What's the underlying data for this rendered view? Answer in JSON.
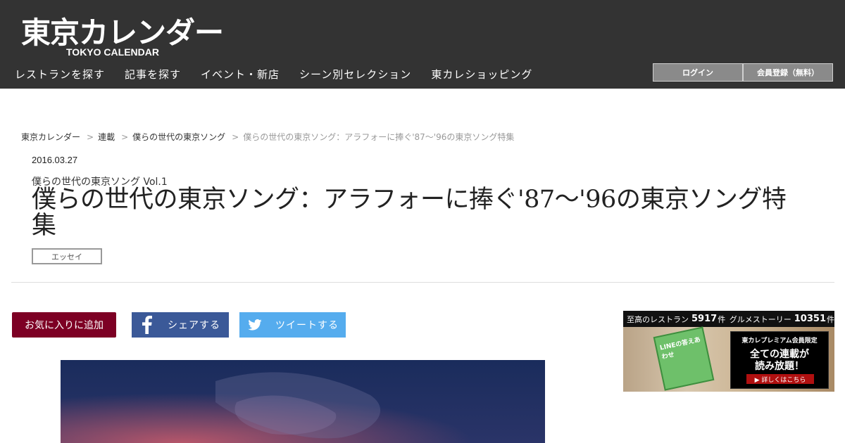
{
  "header": {
    "logo_jp": "東京カレンダー",
    "logo_en": "TOKYO CALENDAR",
    "nav": [
      {
        "label": "レストランを探す"
      },
      {
        "label": "記事を探す"
      },
      {
        "label": "イベント・新店"
      },
      {
        "label": "シーン別セレクション"
      },
      {
        "label": "東カレショッピング"
      }
    ],
    "login_label": "ログイン",
    "register_label": "会員登録（無料）"
  },
  "breadcrumb": {
    "items": [
      "東京カレンダー",
      "連載",
      "僕らの世代の東京ソング"
    ],
    "current": "僕らの世代の東京ソング：アラフォーに捧ぐ'87～'96の東京ソング特集",
    "separator": ">"
  },
  "article": {
    "date": "2016.03.27",
    "series": "僕らの世代の東京ソング Vol.1",
    "title": "僕らの世代の東京ソング：アラフォーに捧ぐ'87～'96の東京ソング特集",
    "tag": "エッセイ"
  },
  "actions": {
    "favorite_label": "お気に入りに追加",
    "share_label": "シェアする",
    "tweet_label": "ツイートする"
  },
  "ad": {
    "restaurants_label": "至高のレストラン",
    "restaurants_count": "5917",
    "restaurants_unit": "件",
    "stories_label": "グルメストーリー",
    "stories_count": "10351",
    "stories_unit": "件",
    "book_text": "LINEの答えあわせ",
    "box_heading": "東カレプレミアム会員限定",
    "box_line1": "全ての連載が",
    "box_line2": "読み放題！",
    "cta": "▶ 詳しくはこちら"
  },
  "colors": {
    "header_bg": "#333333",
    "favorite_bg": "#7d0024",
    "facebook_bg": "#3b5998",
    "twitter_bg": "#55acee"
  }
}
